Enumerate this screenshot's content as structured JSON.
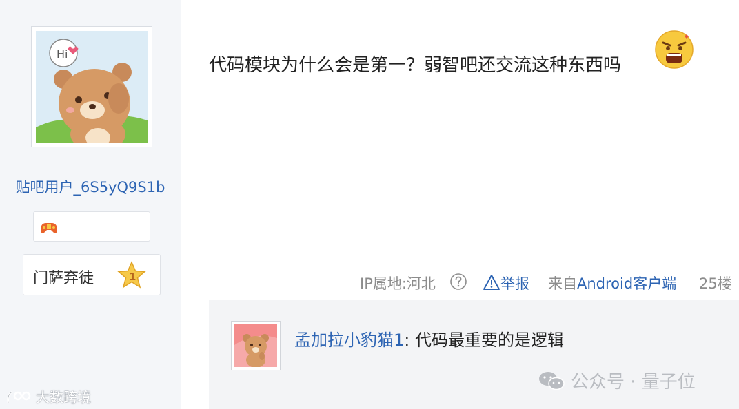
{
  "user": {
    "name": "贴吧用户_6S5yQ9S1b",
    "avatar_bubble": "Hi",
    "level_name": "门萨弃徒",
    "level_number": "1"
  },
  "post": {
    "text": "代码模块为什么会是第一？弱智吧还交流这种东西吗",
    "emoji": "angry-face-icon"
  },
  "meta": {
    "ip_label": "IP属地:河北",
    "report_label": "举报",
    "from_prefix": "来自",
    "client": "Android客户端",
    "floor": "25楼"
  },
  "reply": {
    "user": "孟加拉小豹猫1",
    "separator": ":",
    "text": "代码最重要的是逻辑"
  },
  "watermarks": {
    "wechat": "公众号 · 量子位",
    "corner": "大数跨境"
  },
  "colors": {
    "link_blue": "#2d64b3",
    "sidebar_bg": "#f4f6f9",
    "reply_bg": "#f3f4f6",
    "meta_gray": "#8c8c8c"
  }
}
